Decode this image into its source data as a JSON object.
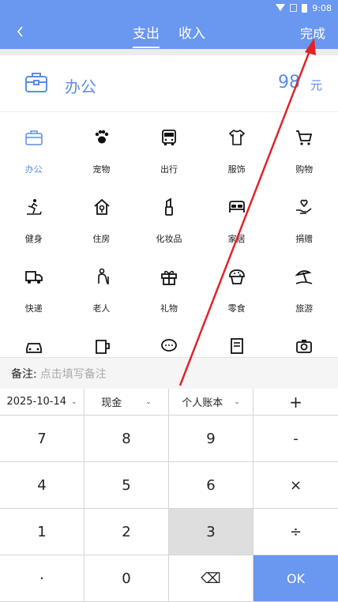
{
  "status_bar": {
    "time": "9:08"
  },
  "header": {
    "back_icon": "chevron-left-icon",
    "tabs": [
      {
        "label": "支出",
        "active": true
      },
      {
        "label": "收入",
        "active": false
      }
    ],
    "done_label": "完成"
  },
  "selected": {
    "name": "办公",
    "amount": "98",
    "unit": "元",
    "icon": "briefcase-icon"
  },
  "categories": [
    {
      "label": "办公",
      "icon": "briefcase-icon",
      "selected": true
    },
    {
      "label": "宠物",
      "icon": "paw-icon"
    },
    {
      "label": "出行",
      "icon": "bus-icon"
    },
    {
      "label": "服饰",
      "icon": "shirt-icon"
    },
    {
      "label": "购物",
      "icon": "cart-icon"
    },
    {
      "label": "健身",
      "icon": "treadmill-icon"
    },
    {
      "label": "住房",
      "icon": "house-icon"
    },
    {
      "label": "化妆品",
      "icon": "lipstick-icon"
    },
    {
      "label": "家居",
      "icon": "bed-icon"
    },
    {
      "label": "捐赠",
      "icon": "donate-heart-icon"
    },
    {
      "label": "快递",
      "icon": "truck-icon"
    },
    {
      "label": "老人",
      "icon": "elder-icon"
    },
    {
      "label": "礼物",
      "icon": "gift-icon"
    },
    {
      "label": "零食",
      "icon": "muffin-icon"
    },
    {
      "label": "旅游",
      "icon": "beach-umbrella-icon"
    },
    {
      "label": "",
      "icon": "car-icon"
    },
    {
      "label": "",
      "icon": "cup-icon"
    },
    {
      "label": "",
      "icon": "chat-icon"
    },
    {
      "label": "",
      "icon": "book-icon"
    },
    {
      "label": "",
      "icon": "camera-icon"
    }
  ],
  "remark": {
    "label": "备注:",
    "placeholder": "点击填写备注"
  },
  "keypad": {
    "date": "2025-10-14",
    "account_type": "现金",
    "book": "个人账本",
    "plus": "+",
    "keys": [
      "7",
      "8",
      "9",
      "-",
      "4",
      "5",
      "6",
      "×",
      "1",
      "2",
      "3",
      "÷",
      "·",
      "0",
      "⌫",
      "OK"
    ]
  },
  "colors": {
    "accent": "#6a97ef",
    "selected_text": "#5b8de6",
    "annotation_arrow": "#e0242a"
  }
}
